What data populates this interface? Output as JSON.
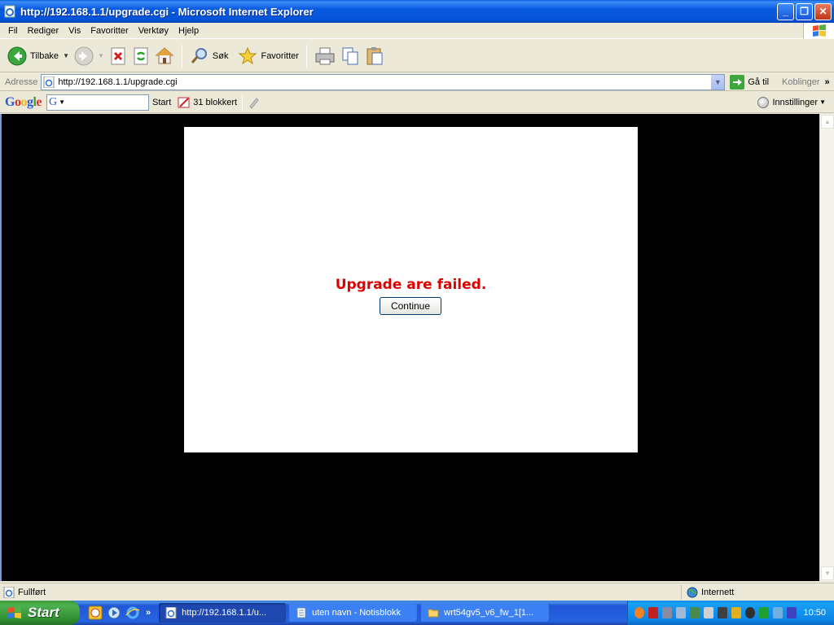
{
  "window": {
    "title": "http://192.168.1.1/upgrade.cgi - Microsoft Internet Explorer"
  },
  "menu": [
    "Fil",
    "Rediger",
    "Vis",
    "Favoritter",
    "Verktøy",
    "Hjelp"
  ],
  "toolbar": {
    "back_label": "Tilbake",
    "search_label": "Søk",
    "favorites_label": "Favoritter"
  },
  "address": {
    "label": "Adresse",
    "url": "http://192.168.1.1/upgrade.cgi",
    "go_label": "Gå til",
    "links_label": "Koblinger",
    "more": "»"
  },
  "google_bar": {
    "logo": "Google",
    "search_icon_letter": "G",
    "start_label": "Start",
    "blocked_label": "31 blokkert",
    "settings_label": "Innstillinger"
  },
  "page": {
    "message": "Upgrade are failed.",
    "button_label": "Continue"
  },
  "status": {
    "text": "Fullført",
    "zone": "Internett"
  },
  "taskbar": {
    "start_label": "Start",
    "more": "»",
    "tasks": [
      {
        "label": "http://192.168.1.1/u..."
      },
      {
        "label": "uten navn - Notisblokk"
      },
      {
        "label": "wrt54gv5_v6_fw_1[1..."
      }
    ],
    "clock": "10:50"
  },
  "colors": {
    "error_text": "#e00000",
    "page_background": "#000000",
    "panel_background": "#ffffff"
  }
}
